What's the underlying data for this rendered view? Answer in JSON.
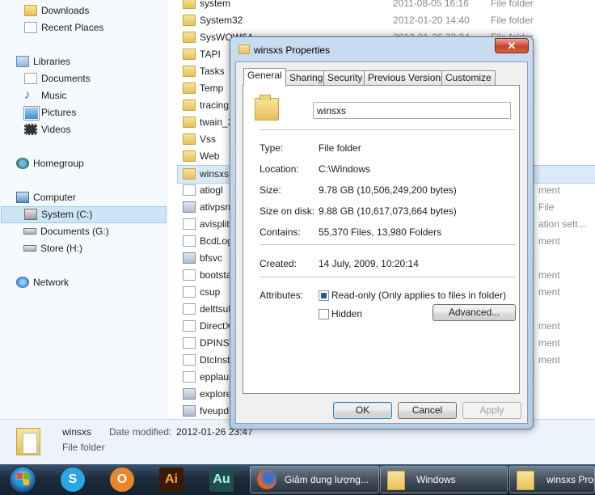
{
  "navigation": {
    "favorites": [
      {
        "label": "Downloads",
        "icon": "downloads-folder-icon"
      },
      {
        "label": "Recent Places",
        "icon": "recent-places-icon"
      }
    ],
    "libraries": {
      "label": "Libraries",
      "items": [
        {
          "label": "Documents",
          "icon": "documents-icon"
        },
        {
          "label": "Music",
          "icon": "music-icon"
        },
        {
          "label": "Pictures",
          "icon": "pictures-icon"
        },
        {
          "label": "Videos",
          "icon": "videos-icon"
        }
      ]
    },
    "homegroup": "Homegroup",
    "computer": {
      "label": "Computer",
      "items": [
        {
          "label": "System (C:)",
          "selected": true
        },
        {
          "label": "Documents (G:)"
        },
        {
          "label": "Store (H:)"
        }
      ]
    },
    "network": "Network"
  },
  "file_list": {
    "rows": [
      {
        "name": "system",
        "date": "2011-08-05 16:16",
        "type": "File folder",
        "icon": "folder"
      },
      {
        "name": "System32",
        "date": "2012-01-20 14:40",
        "type": "File folder",
        "icon": "folder"
      },
      {
        "name": "SysWOW64",
        "date": "2012-01-26 23:34",
        "type": "File folder",
        "icon": "folder"
      },
      {
        "name": "TAPI",
        "date": "",
        "type": "",
        "icon": "folder"
      },
      {
        "name": "Tasks",
        "date": "",
        "type": "",
        "icon": "folder"
      },
      {
        "name": "Temp",
        "date": "",
        "type": "",
        "icon": "folder"
      },
      {
        "name": "tracing",
        "date": "",
        "type": "",
        "icon": "folder"
      },
      {
        "name": "twain_3",
        "date": "",
        "type": "",
        "icon": "folder"
      },
      {
        "name": "Vss",
        "date": "",
        "type": "",
        "icon": "folder"
      },
      {
        "name": "Web",
        "date": "",
        "type": "",
        "icon": "folder"
      },
      {
        "name": "winsxs",
        "date": "",
        "type": "",
        "icon": "folder",
        "selected": true
      },
      {
        "name": "atiogl",
        "date": "",
        "type": "ment",
        "icon": "file"
      },
      {
        "name": "ativpsrr",
        "date": "",
        "type": "File",
        "icon": "app"
      },
      {
        "name": "avisplit",
        "date": "",
        "type": "ation sett...",
        "icon": "file"
      },
      {
        "name": "BcdLog",
        "date": "",
        "type": "ment",
        "icon": "file"
      },
      {
        "name": "bfsvc",
        "date": "",
        "type": "",
        "icon": "app"
      },
      {
        "name": "bootsta",
        "date": "",
        "type": "ment",
        "icon": "file"
      },
      {
        "name": "csup",
        "date": "",
        "type": "ment",
        "icon": "file"
      },
      {
        "name": "delttsul",
        "date": "",
        "type": "",
        "icon": "file"
      },
      {
        "name": "DirectX",
        "date": "",
        "type": "ment",
        "icon": "file"
      },
      {
        "name": "DPINST",
        "date": "",
        "type": "ment",
        "icon": "file"
      },
      {
        "name": "DtcInsti",
        "date": "",
        "type": "ment",
        "icon": "file"
      },
      {
        "name": "epplaun",
        "date": "",
        "type": "",
        "icon": "file"
      },
      {
        "name": "explore",
        "date": "",
        "type": "",
        "icon": "app"
      },
      {
        "name": "fveupd",
        "date": "",
        "type": "",
        "icon": "app"
      }
    ]
  },
  "details_pane": {
    "name": "winsxs",
    "type": "File folder",
    "date_label": "Date modified:",
    "date_value": "2012-01-26 23:47"
  },
  "taskbar": {
    "start_icon": "windows-start-orb-icon",
    "pinned": [
      {
        "name": "skype-icon",
        "glyph": "S",
        "color": "#2aa6e4"
      },
      {
        "name": "outlook-icon",
        "glyph": "O",
        "color": "#e8862a"
      },
      {
        "name": "illustrator-icon",
        "glyph": "Ai",
        "color": "#3b1a05"
      },
      {
        "name": "audition-icon",
        "glyph": "Au",
        "color": "#1f4d4f"
      }
    ],
    "tasks": [
      {
        "label": "Giảm dung lượng...",
        "icon": "firefox-icon"
      },
      {
        "label": "Windows",
        "icon": "folder-icon"
      },
      {
        "label": "winsxs Prop",
        "icon": "folder-icon"
      }
    ]
  },
  "dialog": {
    "title": "winsxs Properties",
    "close_glyph": "✕",
    "tabs": [
      "General",
      "Sharing",
      "Security",
      "Previous Versions",
      "Customize"
    ],
    "active_tab": "General",
    "folder_name": "winsxs",
    "properties": [
      {
        "label": "Type:",
        "value": "File folder"
      },
      {
        "label": "Location:",
        "value": "C:\\Windows"
      },
      {
        "label": "Size:",
        "value": "9.78 GB (10,506,249,200 bytes)"
      },
      {
        "label": "Size on disk:",
        "value": "9.88 GB (10,617,073,664 bytes)"
      },
      {
        "label": "Contains:",
        "value": "55,370 Files, 13,980 Folders"
      }
    ],
    "created": {
      "label": "Created:",
      "value": "14 July, 2009, 10:20:14"
    },
    "attributes": {
      "label": "Attributes:",
      "readonly": {
        "label": "Read-only (Only applies to files in folder)",
        "checked": true
      },
      "hidden": {
        "label": "Hidden",
        "checked": false
      },
      "advanced_label": "Advanced..."
    },
    "buttons": {
      "ok": "OK",
      "cancel": "Cancel",
      "apply": "Apply"
    }
  }
}
